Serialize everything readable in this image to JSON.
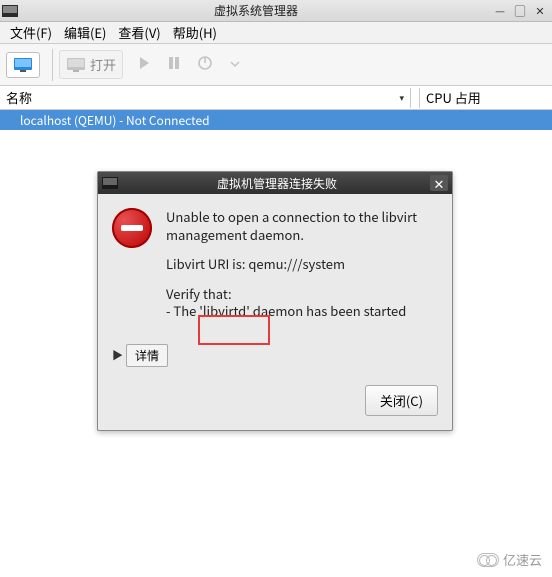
{
  "window": {
    "title": "虚拟系统管理器"
  },
  "menu": {
    "file": "文件(F)",
    "edit": "编辑(E)",
    "view": "查看(V)",
    "help": "帮助(H)"
  },
  "toolbar": {
    "open_label": "打开"
  },
  "columns": {
    "name": "名称",
    "cpu": "CPU 占用"
  },
  "list": {
    "items": [
      {
        "label": "localhost (QEMU) - Not Connected"
      }
    ]
  },
  "dialog": {
    "title": "虚拟机管理器连接失败",
    "message_line1": "Unable to open a connection to the libvirt management daemon.",
    "uri_line": "Libvirt URI is: qemu:///system",
    "verify_label": "Verify that:",
    "verify_item1": " - The 'libvirtd' daemon has been started",
    "details_label": "详情",
    "close_label": "关闭(C)"
  },
  "watermark": {
    "text": "亿速云"
  }
}
